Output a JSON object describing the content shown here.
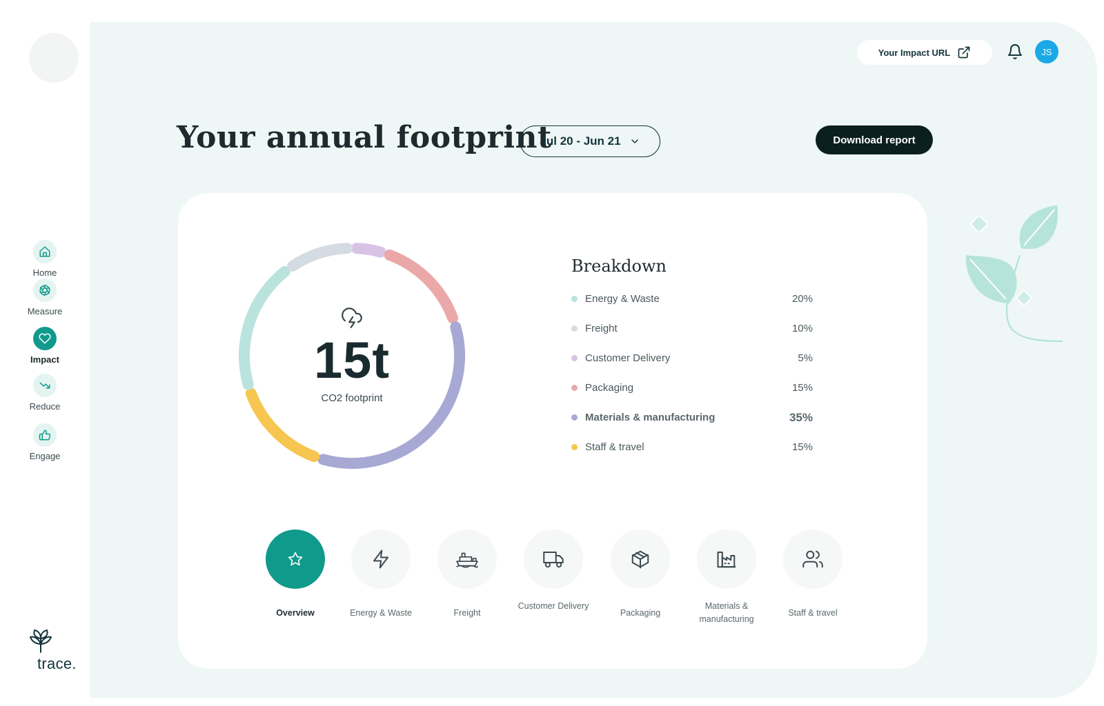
{
  "topbar": {
    "impact_url_label": "Your Impact URL",
    "user_initials": "JS"
  },
  "sidebar": {
    "items": [
      {
        "label": "Home",
        "icon": "home-icon",
        "active": false
      },
      {
        "label": "Measure",
        "icon": "aperture-icon",
        "active": false
      },
      {
        "label": "Impact",
        "icon": "heart-icon",
        "active": true
      },
      {
        "label": "Reduce",
        "icon": "trending-down-icon",
        "active": false
      },
      {
        "label": "Engage",
        "icon": "thumbs-up-icon",
        "active": false
      }
    ],
    "logo_text": "trace."
  },
  "header": {
    "title": "Your annual footprint",
    "date_range": "Jul 20 - Jun 21",
    "download_label": "Download report"
  },
  "summary": {
    "value": "15t",
    "caption": "CO2 footprint"
  },
  "breakdown": {
    "title": "Breakdown",
    "items": [
      {
        "name": "Energy & Waste",
        "percent": "20%",
        "color": "#b9e3dc"
      },
      {
        "name": "Freight",
        "percent": "10%",
        "color": "#d5dbe2"
      },
      {
        "name": "Customer Delivery",
        "percent": "5%",
        "color": "#d8c3e6"
      },
      {
        "name": "Packaging",
        "percent": "15%",
        "color": "#eaa8a8"
      },
      {
        "name": "Materials & manufacturing",
        "percent": "35%",
        "color": "#a7a9d4"
      },
      {
        "name": "Staff & travel",
        "percent": "15%",
        "color": "#f6c650"
      }
    ]
  },
  "categories": [
    {
      "label": "Overview",
      "icon": "star-icon",
      "active": true
    },
    {
      "label": "Energy & Waste",
      "icon": "lightning-icon",
      "active": false
    },
    {
      "label": "Freight",
      "icon": "ship-icon",
      "active": false
    },
    {
      "label": "Customer Delivery",
      "icon": "truck-icon",
      "active": false
    },
    {
      "label": "Packaging",
      "icon": "box-icon",
      "active": false
    },
    {
      "label": "Materials & manufacturing",
      "icon": "factory-icon",
      "active": false
    },
    {
      "label": "Staff & travel",
      "icon": "users-icon",
      "active": false
    }
  ],
  "colors": {
    "accent": "#0f9a8c",
    "background": "#eef7f5",
    "avatar": "#1ba8e6",
    "download_button": "#0b1f1f"
  }
}
